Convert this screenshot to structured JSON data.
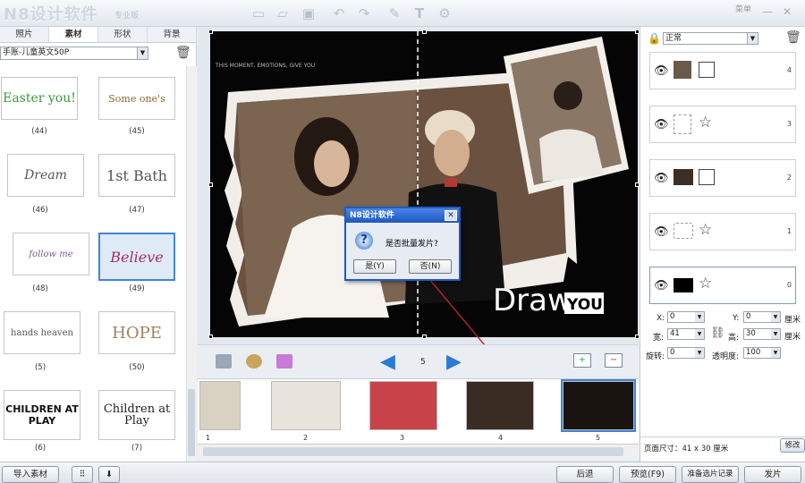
{
  "app": {
    "logo": "N8设计软件",
    "edition": "专业版",
    "menu": "菜单"
  },
  "left_panel": {
    "tabs": [
      "照片",
      "素材",
      "形状",
      "背景"
    ],
    "category": "手账-儿童英文50P",
    "thumbs": [
      {
        "text": "Easter you!",
        "label": "(44)"
      },
      {
        "text": "Some one's",
        "label": "(45)"
      },
      {
        "text": "Dream",
        "label": "(46)"
      },
      {
        "text": "1st Bath",
        "label": "(47)"
      },
      {
        "text": "follow me",
        "label": "(48)"
      },
      {
        "text": "Believe",
        "label": "(49)"
      },
      {
        "text": "hands heaven",
        "label": "(5)"
      },
      {
        "text": "HOPE",
        "label": "(50)"
      },
      {
        "text": "CHILDREN AT PLAY",
        "label": "(6)"
      },
      {
        "text": "Children at Play",
        "label": "(7)"
      }
    ]
  },
  "canvas": {
    "caption_small": "THIS MOMENT, EMOTIONS, GIVE YOU",
    "draw": "Draw",
    "you": "YOU",
    "page_number": "5"
  },
  "dialog": {
    "title": "N8设计软件",
    "message": "是否批量发片?",
    "yes": "是(Y)",
    "no": "否(N)"
  },
  "filmstrip": {
    "pages": [
      "1",
      "2",
      "3",
      "4",
      "5"
    ],
    "selected": 5
  },
  "right_panel": {
    "blend_mode": "正常",
    "layers": [
      "4",
      "3",
      "2",
      "1",
      "0"
    ],
    "x_label": "X:",
    "x_value": "0",
    "y_label": "Y:",
    "y_value": "0",
    "w_label": "宽:",
    "w_value": "41",
    "h_label": "高:",
    "h_value": "30",
    "unit": "厘米",
    "rotate_label": "旋转:",
    "rotate_value": "0",
    "opacity_label": "透明度:",
    "opacity_value": "100",
    "page_size": "页面尺寸：41 x 30 厘米",
    "edit": "修改"
  },
  "bottom": {
    "import": "导入素材",
    "back": "后退",
    "preview": "预览(F9)",
    "prepare": "准备选片记录",
    "send": "发片"
  },
  "colors": {
    "accent": "#3f86d8",
    "dialog_title": "#1c55c2",
    "arrow": "#2b7bd6"
  }
}
